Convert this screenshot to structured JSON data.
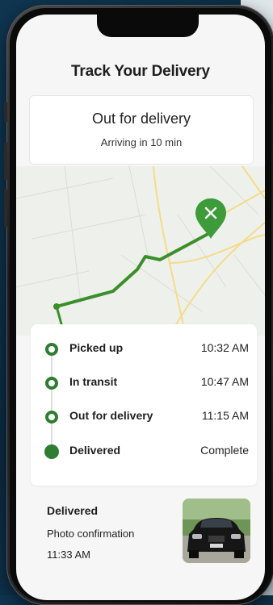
{
  "screen": {
    "title": "Track Your Delivery"
  },
  "status": {
    "title": "Out for delivery",
    "subtitle": "Arriving in 10 min"
  },
  "map": {
    "accent_color": "#2e7d32",
    "pin_icon": "x-mark-icon"
  },
  "timeline": [
    {
      "label": "Picked up",
      "time": "10:32 AM",
      "state": "done"
    },
    {
      "label": "In transit",
      "time": "10:47 AM",
      "state": "done"
    },
    {
      "label": "Out for delivery",
      "time": "11:15 AM",
      "state": "done"
    },
    {
      "label": "Delivered",
      "time": "Complete",
      "state": "complete"
    }
  ],
  "footer": {
    "title": "Delivered",
    "subtitle": "Photo confirmation",
    "time": "11:33 AM"
  }
}
